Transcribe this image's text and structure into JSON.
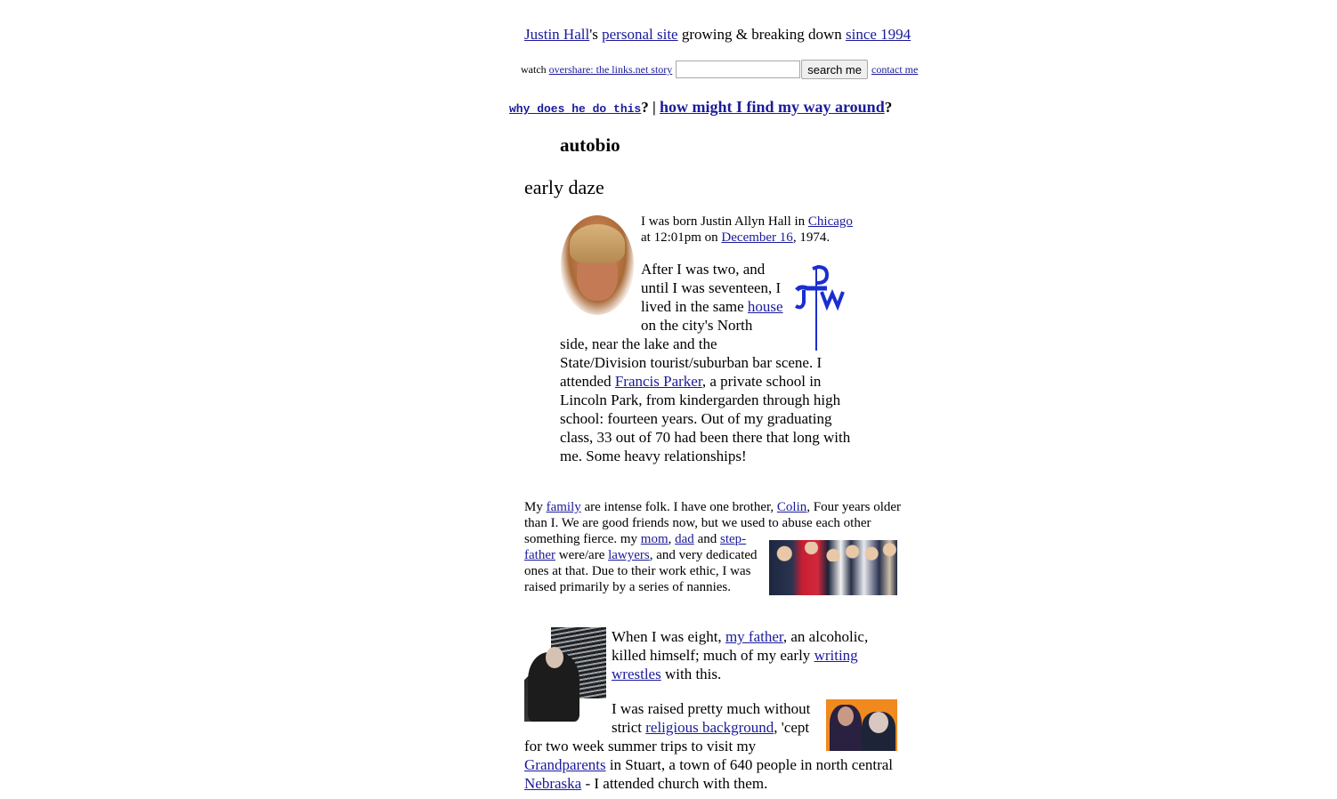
{
  "header": {
    "author_link": "Justin Hall",
    "possessive": "'s ",
    "site_link": "personal site",
    "middle": " growing & breaking down ",
    "since_link": "since 1994"
  },
  "search_row": {
    "watch_label": "watch",
    "overshare_link": "overshare: the links.net story",
    "search_value": "",
    "search_placeholder": "",
    "search_button": "search me",
    "contact_link": "contact me"
  },
  "nav": {
    "why_link": "why does he do this",
    "why_q": "?",
    "separator": " | ",
    "how_link": "how might I find my way around",
    "how_q": "?"
  },
  "page": {
    "title": "autobio",
    "section_title": "early daze"
  },
  "block1": {
    "portrait_alt": "childhood portrait",
    "p1": {
      "t1": "I was born Justin Allyn Hall in ",
      "chicago_link": "Chicago",
      "t2": " at 12:01pm on ",
      "date_link": "December 16",
      "t3": ", 1974."
    },
    "p2": {
      "t1": "After I was two, and until I was seventeen, I lived in the same ",
      "house_link": "house",
      "t2": " on the city's North side, near the lake and the State/Division tourist/suburban bar scene. I attended ",
      "parker_link": "Francis Parker",
      "t3": ", a private school in Lincoln Park, from kindergarden through high school: fourteen years. Out of my graduating class, 33 out of 70 had been there that long with me. Some heavy relationships!"
    },
    "monogram_color": "#1a2ed0"
  },
  "block2": {
    "t1": "My ",
    "family_link": "family",
    "t2": " are intense folk. I have one brother, ",
    "colin_link": "Colin",
    "t3": ", Four years older than I. We are good friends now, but we used to abuse each other something fierce. my ",
    "mom_link": "mom",
    "t4": ", ",
    "dad_link": "dad",
    "t5": " and ",
    "step_link": "step-father",
    "t6": " were/are ",
    "lawyers_link": "lawyers",
    "t7": ", and very dedicated ones at that. Due to their work ethic, I was raised primarily by a series of nannies."
  },
  "block3": {
    "p1": {
      "t1": "When I was eight, ",
      "father_link": "my father",
      "t2": ", an alcoholic, killed himself; much of my early ",
      "writing_link": "writing wrestles",
      "t3": " with this."
    },
    "p2": {
      "t1": "I was raised pretty much without strict ",
      "religious_link": "religious background",
      "t2": ", 'cept for two week summer trips to visit my ",
      "grandparents_link": "Grandparents",
      "t3": " in Stuart, a town of 640 people in north central ",
      "nebraska_link": "Nebraska",
      "t4": " - I attended church with them."
    }
  },
  "colors": {
    "link": "#1a1a9c",
    "text": "#000000",
    "background": "#ffffff"
  }
}
